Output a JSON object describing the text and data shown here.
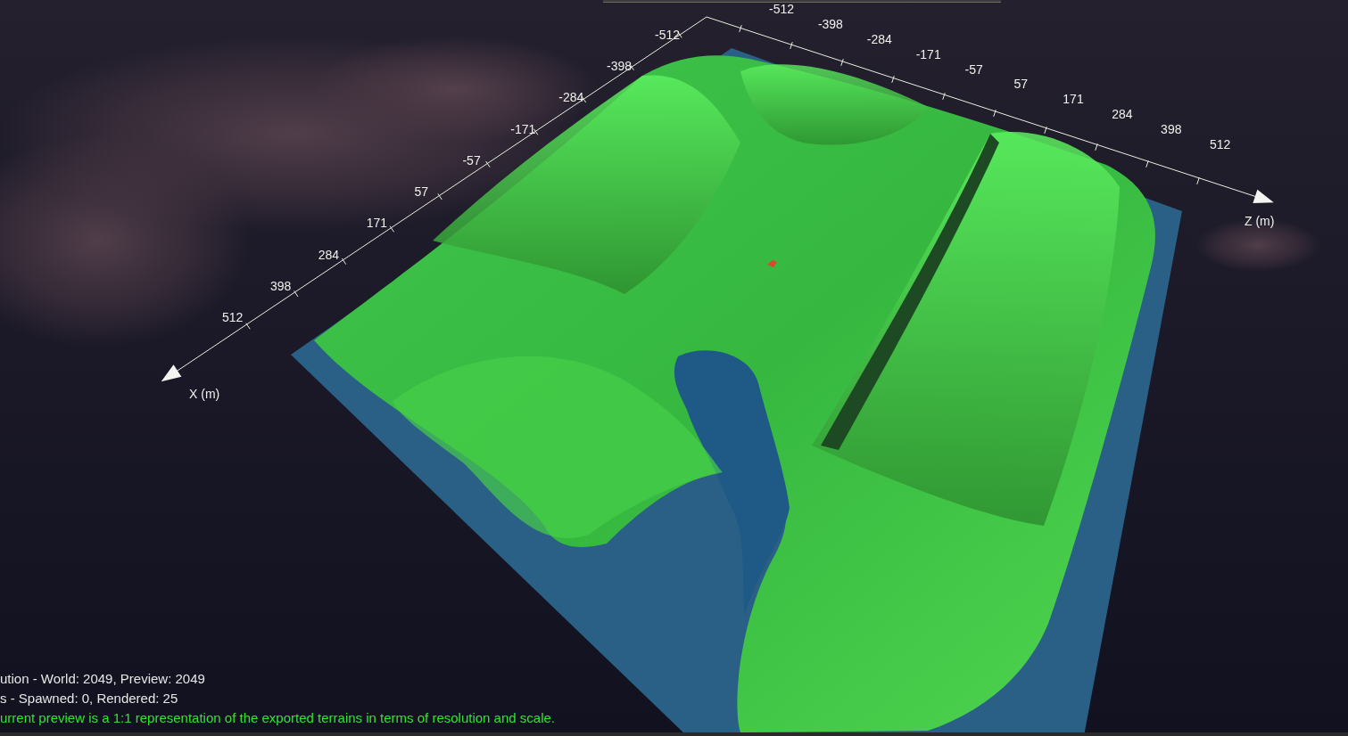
{
  "viewport": {
    "x_axis": {
      "title": "X (m)",
      "ticks": [
        "-512",
        "-398",
        "-284",
        "-171",
        "-57",
        "57",
        "171",
        "284",
        "398",
        "512"
      ]
    },
    "z_axis": {
      "title": "Z (m)",
      "ticks": [
        "-512",
        "-398",
        "-284",
        "-171",
        "-57",
        "57",
        "171",
        "284",
        "398",
        "512"
      ]
    },
    "status_lines": [
      {
        "kind": "info",
        "text": "ution - World: 2049, Preview: 2049"
      },
      {
        "kind": "info",
        "text": "s - Spawned: 0, Rendered: 25"
      },
      {
        "kind": "success",
        "text": "urrent preview is a 1:1 representation of the exported terrains in terms of resolution and scale."
      }
    ]
  }
}
